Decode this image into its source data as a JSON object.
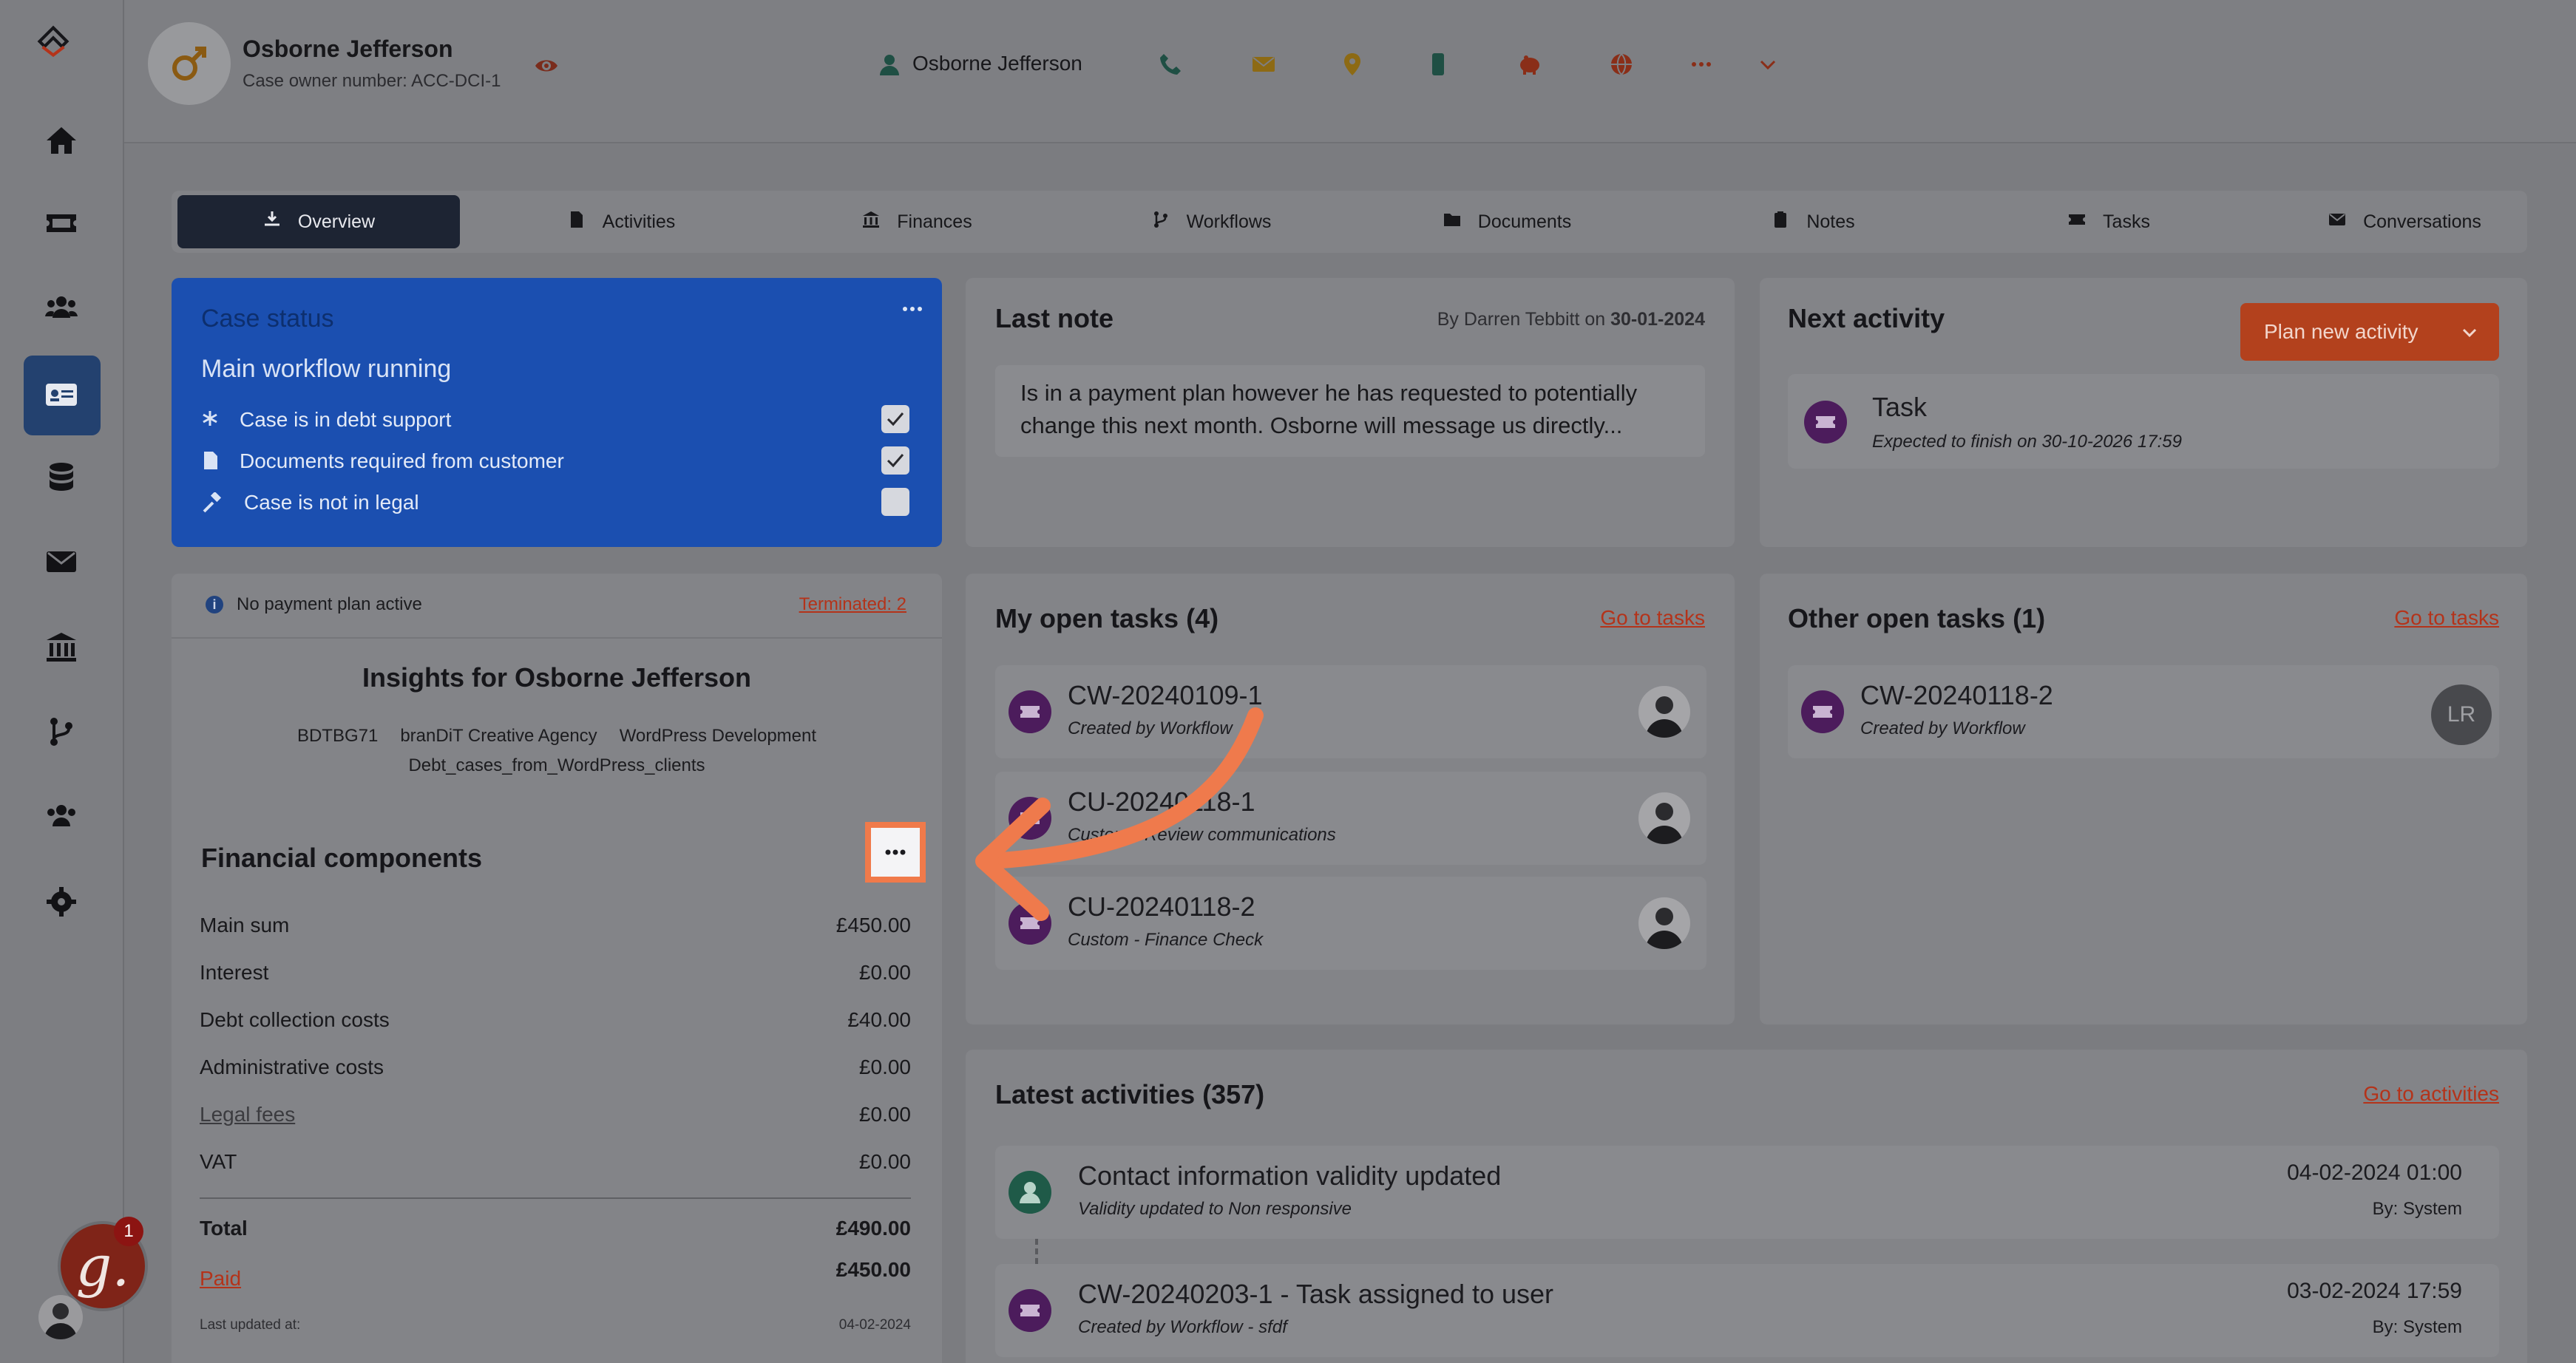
{
  "header": {
    "name": "Osborne Jefferson",
    "case_owner": "Case owner number: ACC-DCI-1",
    "contact_name": "Osborne Jefferson"
  },
  "tabs": [
    {
      "label": "Overview"
    },
    {
      "label": "Activities"
    },
    {
      "label": "Finances"
    },
    {
      "label": "Workflows"
    },
    {
      "label": "Documents"
    },
    {
      "label": "Notes"
    },
    {
      "label": "Tasks"
    },
    {
      "label": "Conversations"
    }
  ],
  "case_status": {
    "title": "Case status",
    "subtitle": "Main workflow running",
    "items": [
      {
        "label": "Case is in debt support",
        "checked": true
      },
      {
        "label": "Documents required from customer",
        "checked": true
      },
      {
        "label": "Case is not in legal",
        "checked": false
      }
    ]
  },
  "last_note": {
    "title": "Last note",
    "by_prefix": "By Darren Tebbitt on",
    "date": "30-01-2024",
    "text_line1": "Is in a payment plan however he has requested to potentially",
    "text_line2": "change this next month. Osborne will message us directly..."
  },
  "next_activity": {
    "title": "Next activity",
    "button": "Plan new activity",
    "item_title": "Task",
    "item_sub": "Expected to finish on 30-10-2026 17:59"
  },
  "payment": {
    "status": "No payment plan active",
    "terminated": "Terminated: 2"
  },
  "insights": {
    "title": "Insights for Osborne Jefferson",
    "tags_line1": [
      "BDTBG71",
      "branDiT Creative Agency",
      "WordPress Development"
    ],
    "tags_line2": "Debt_cases_from_WordPress_clients"
  },
  "financial": {
    "title": "Financial components",
    "rows": [
      {
        "label": "Main sum",
        "value": "£450.00"
      },
      {
        "label": "Interest",
        "value": "£0.00"
      },
      {
        "label": "Debt collection costs",
        "value": "£40.00"
      },
      {
        "label": "Administrative costs",
        "value": "£0.00"
      },
      {
        "label": "Legal fees",
        "value": "£0.00"
      },
      {
        "label": "VAT",
        "value": "£0.00"
      }
    ],
    "total_label": "Total",
    "total_value": "£490.00",
    "paid_label": "Paid",
    "paid_value": "£450.00",
    "updated_label": "Last updated at:",
    "updated_value": "04-02-2024"
  },
  "my_tasks": {
    "title": "My open tasks (4)",
    "link": "Go to tasks",
    "items": [
      {
        "id": "CW-20240109-1",
        "sub": "Created by Workflow"
      },
      {
        "id": "CU-20240118-1",
        "sub": "Custom - Review communications"
      },
      {
        "id": "CU-20240118-2",
        "sub": "Custom - Finance Check"
      }
    ]
  },
  "other_tasks": {
    "title": "Other open tasks (1)",
    "link": "Go to tasks",
    "items": [
      {
        "id": "CW-20240118-2",
        "sub": "Created by Workflow",
        "initials": "LR"
      }
    ]
  },
  "latest": {
    "title": "Latest activities (357)",
    "link": "Go to activities",
    "items": [
      {
        "title": "Contact information validity updated",
        "sub": "Validity updated to Non responsive",
        "date": "04-02-2024 01:00",
        "by": "By: System"
      },
      {
        "title": "CW-20240203-1 - Task assigned to user",
        "sub": "Created by Workflow - sfdf",
        "date": "03-02-2024 17:59",
        "by": "By: System"
      }
    ]
  },
  "badge": {
    "count": "1",
    "letter": "g."
  },
  "colors": {
    "accent": "#c2451f",
    "status_card": "#1b4fb0",
    "arrow": "#ef7a4c"
  }
}
